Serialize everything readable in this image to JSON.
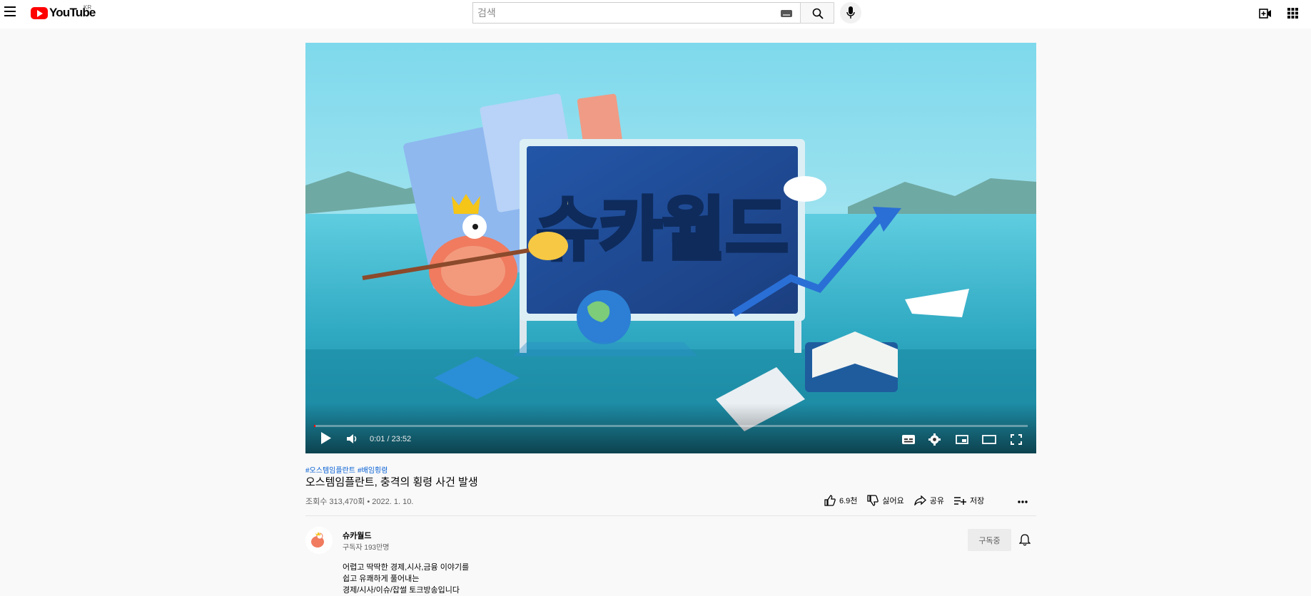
{
  "header": {
    "logo_text": "YouTube",
    "region": "KR",
    "search_placeholder": "검색"
  },
  "player": {
    "time": "0:01 / 23:52",
    "progress_fraction": 0.0007,
    "show_title": "슈카월드"
  },
  "video": {
    "hashtags": [
      "#오스템임플란트",
      "#배임횡령"
    ],
    "title": "오스템임플란트, 충격의 횡령 사건 발생",
    "meta": "조회수 313,470회 • 2022. 1. 10."
  },
  "actions": {
    "like": "6.9천",
    "dislike": "싫어요",
    "share": "공유",
    "save": "저장"
  },
  "channel": {
    "name": "슈카월드",
    "subscribers": "구독자 193만명",
    "subscribe_label": "구독중"
  },
  "description": {
    "lines": [
      "어렵고 딱딱한 경제,시사,금융 이야기를",
      "쉽고 유쾌하게 풀어내는",
      "경제/시사/이슈/잡썰 토크방송입니다"
    ]
  },
  "colors": {
    "brand_red": "#ff0000",
    "link_blue": "#065fd4",
    "background": "#f9f9f9"
  }
}
